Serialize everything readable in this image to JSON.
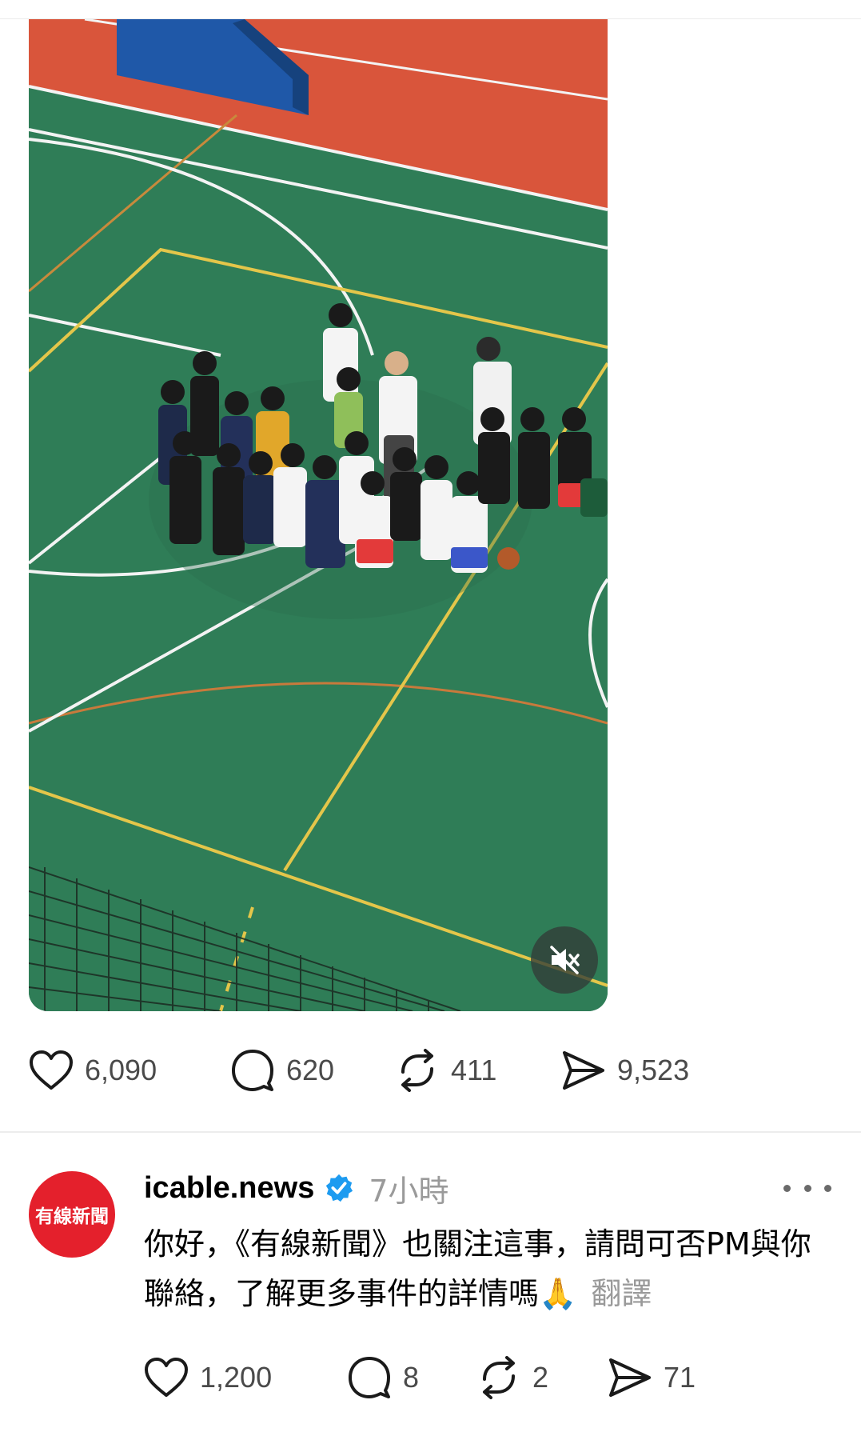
{
  "post": {
    "stats": {
      "likes": "6,090",
      "comments": "620",
      "reposts": "411",
      "shares": "9,523"
    }
  },
  "reply": {
    "avatar_text": "有線新聞",
    "username": "icable.news",
    "time": "7小時",
    "text": "你好，《有線新聞》也關注這事，請問可否PM與你聯絡，了解更多事件的詳情嗎🙏",
    "translate_label": "翻譯",
    "stats": {
      "likes": "1,200",
      "comments": "8",
      "reposts": "2",
      "shares": "71"
    }
  },
  "icons": [
    "heart-icon",
    "comment-icon",
    "repost-icon",
    "share-icon",
    "mute-icon",
    "verified-badge-icon",
    "more-options-icon"
  ],
  "colors": {
    "court_green": "#2f7d57",
    "track_red": "#d9553b",
    "avatar_red": "#e4202c",
    "verified_blue": "#1d9bf0",
    "secondary_text": "#9a9a9a"
  }
}
